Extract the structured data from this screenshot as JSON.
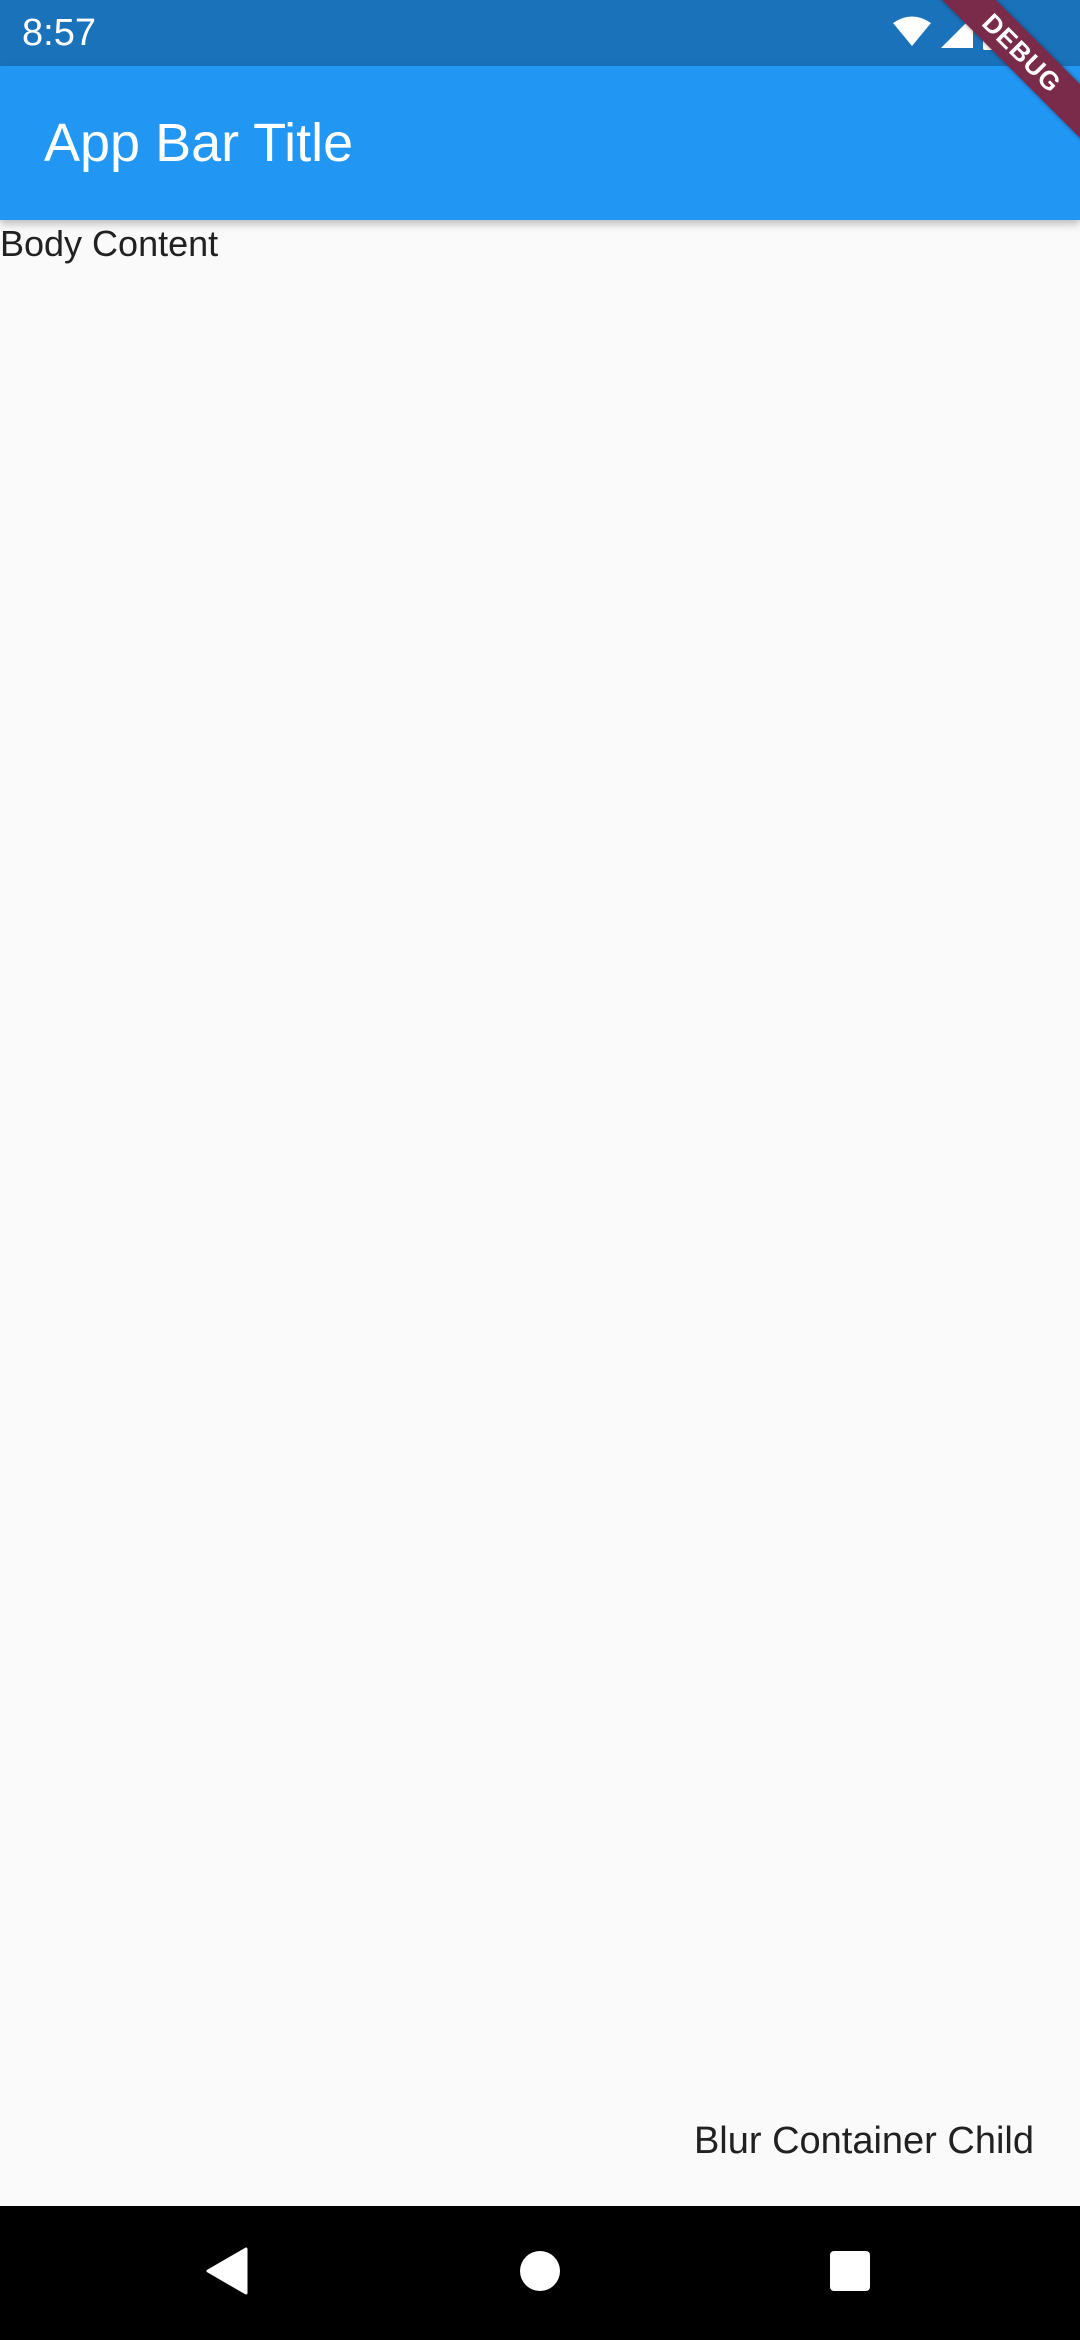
{
  "status_bar": {
    "time": "8:57",
    "icons": [
      "wifi-icon",
      "cell-signal-icon",
      "battery-icon"
    ],
    "background": "#1A72BB"
  },
  "app_bar": {
    "title": "App Bar Title",
    "background": "#2196F3"
  },
  "debug_banner": {
    "label": "DEBUG",
    "color": "#7A2B4A"
  },
  "body": {
    "content": "Body Content",
    "blur_container_child": "Blur Container Child",
    "background": "#FAFAFA"
  },
  "nav_bar": {
    "buttons": [
      "back-icon",
      "home-icon",
      "recents-icon"
    ]
  }
}
